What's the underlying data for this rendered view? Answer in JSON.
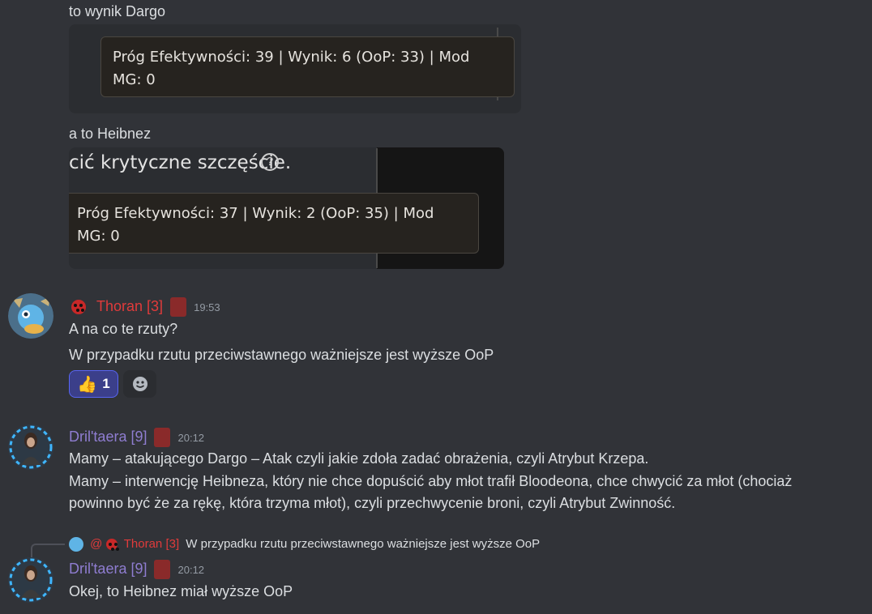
{
  "messages_top": {
    "line1": "to wynik Dargo",
    "roll1_line1": "Próg Efektywności: 39 | Wynik: 6 (OoP: 33) | Mod",
    "roll1_line2": "MG: 0",
    "line2": "a to Heibnez",
    "crit_text": "cić krytyczne szczęście.",
    "crit_help": "?",
    "roll2_line1": "Próg Efektywności: 37 | Wynik: 2 (OoP: 35) | Mod",
    "roll2_line2": "MG: 0"
  },
  "msg_thoran": {
    "username": "Thoran [3]",
    "timestamp": "19:53",
    "line1": "A na co te rzuty?",
    "line2": "W przypadku rzutu przeciwstawnego ważniejsze jest wyższe OoP",
    "reaction_count": "1",
    "user_color": "#e03b3b"
  },
  "msg_dril1": {
    "username": "Dril'taera [9]",
    "timestamp": "20:12",
    "line1": "Mamy – atakującego Dargo – Atak czyli jakie zdoła zadać obrażenia, czyli Atrybut Krzepa.",
    "line2": "Mamy – interwencję Heibneza, który nie chce dopuścić aby młot trafił Bloodeona, chce chwycić za młot (chociaż",
    "line3": "powinno być że za rękę, która trzyma młot), czyli przechwycenie broni, czyli Atrybut Zwinność.",
    "user_color": "#8f7dd1"
  },
  "reply": {
    "mention": "@",
    "username": "Thoran [3]",
    "text": "W przypadku rzutu przeciwstawnego ważniejsze jest wyższe OoP"
  },
  "msg_dril2": {
    "username": "Dril'taera [9]",
    "timestamp": "20:12",
    "line1": "Okej, to Heibnez miał wyższe OoP"
  },
  "icons": [
    "ladybug-icon",
    "thumbs-up-icon",
    "add-reaction-icon",
    "role-badge-icon",
    "help-icon"
  ]
}
